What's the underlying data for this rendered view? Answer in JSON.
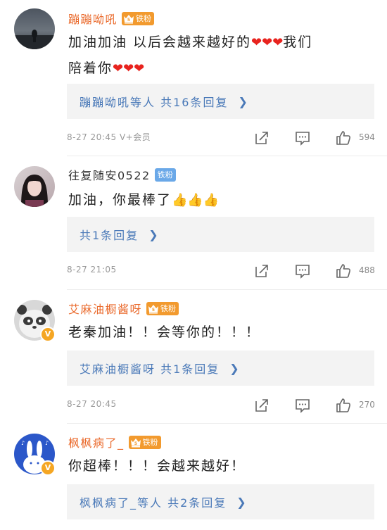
{
  "comments": [
    {
      "username": "蹦蹦呦吼",
      "badge": "铁粉",
      "content_line1": "加油加油 以后会越来越好的",
      "content_line1_b": "我们",
      "content_line2": "陪着你",
      "hearts": "❤❤❤",
      "reply_text": "蹦蹦呦吼等人 共16条回复",
      "meta": "8-27 20:45 V+会员",
      "likes": "594"
    },
    {
      "username": "往复随安0522",
      "badge": "铁粉",
      "content": "加油，你最棒了",
      "thumbs": "👍👍👍",
      "reply_text": "共1条回复",
      "meta": "8-27 21:05",
      "likes": "488"
    },
    {
      "username": "艾麻油橱酱呀",
      "badge": "铁粉",
      "content": "老秦加油！！会等你的！！！",
      "reply_text": "艾麻油橱酱呀 共1条回复",
      "meta": "8-27 20:45",
      "likes": "270"
    },
    {
      "username": "枫枫病了_",
      "badge": "铁粉",
      "content": "你超棒！！！会越来越好！",
      "reply_text": "枫枫病了_等人 共2条回复"
    }
  ],
  "icons": {
    "share": "share-icon",
    "comment": "comment-icon",
    "like": "like-icon",
    "reply_chevron": "chevron-right-icon",
    "verified": "verified-v-icon"
  },
  "colors": {
    "username_orange": "#ea6a2c",
    "reply_link_blue": "#4a79b8",
    "badge_orange": "#f29a2e",
    "badge_blue": "#6aa8e8",
    "heart_red": "#e8231e"
  }
}
